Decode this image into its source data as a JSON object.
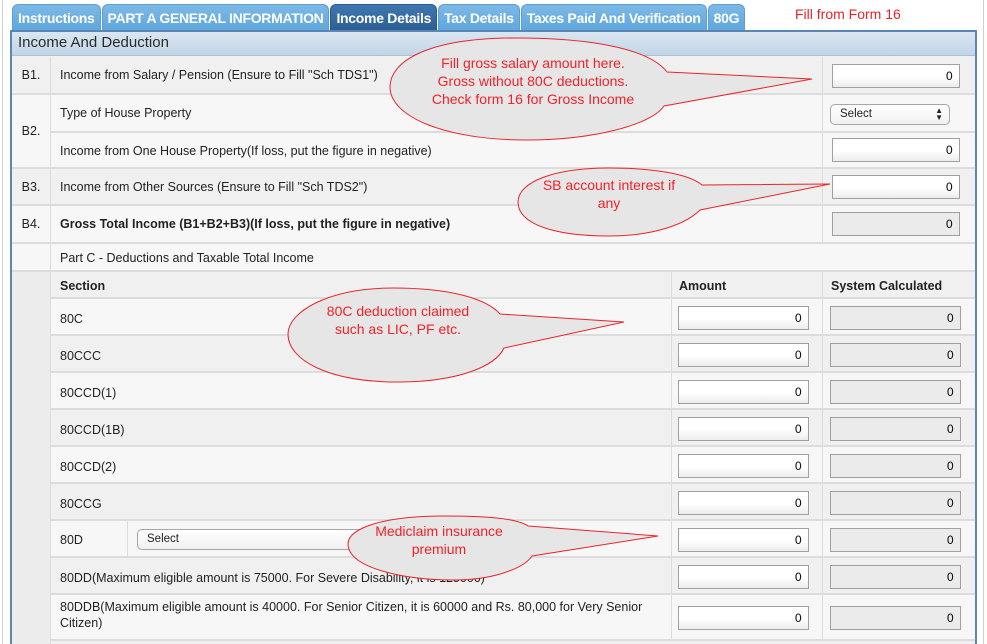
{
  "tabs": [
    {
      "label": "Instructions",
      "active": false
    },
    {
      "label": "PART A GENERAL INFORMATION",
      "active": false
    },
    {
      "label": "Income Details",
      "active": true
    },
    {
      "label": "Tax Details",
      "active": false
    },
    {
      "label": "Taxes Paid And Verification",
      "active": false
    },
    {
      "label": "80G",
      "active": false
    }
  ],
  "top_note": "Fill from Form 16",
  "panel": {
    "title": "Income And Deduction"
  },
  "income": {
    "b1": {
      "num": "B1.",
      "label": "Income from Salary / Pension (Ensure to Fill \"Sch TDS1\")",
      "value": "0"
    },
    "b2": {
      "num": "B2.",
      "type_label": "Type of House Property",
      "type_select": "Select",
      "label": "Income from One House Property(If loss, put the figure in negative)",
      "value": "0"
    },
    "b3": {
      "num": "B3.",
      "label": "Income from Other Sources (Ensure to Fill \"Sch TDS2\")",
      "value": "0"
    },
    "b4": {
      "num": "B4.",
      "label": "Gross Total Income (B1+B2+B3)(If loss, put the figure in negative)",
      "value": "0"
    }
  },
  "part_c": {
    "title": "Part C - Deductions and Taxable Total Income",
    "headers": {
      "section": "Section",
      "amount": "Amount",
      "system": "System Calculated"
    },
    "rows": [
      {
        "section": "80C",
        "amount": "0",
        "system": "0"
      },
      {
        "section": "80CCC",
        "amount": "0",
        "system": "0"
      },
      {
        "section": "80CCD(1)",
        "amount": "0",
        "system": "0"
      },
      {
        "section": "80CCD(1B)",
        "amount": "0",
        "system": "0"
      },
      {
        "section": "80CCD(2)",
        "amount": "0",
        "system": "0"
      },
      {
        "section": "80CCG",
        "amount": "0",
        "system": "0"
      },
      {
        "section": "80D",
        "select": "Select",
        "amount": "0",
        "system": "0"
      },
      {
        "section": "80DD(Maximum eligible amount is 75000. For Severe Disability, it is 125000)",
        "amount": "0",
        "system": "0"
      },
      {
        "section": "80DDB(Maximum eligible amount is 40000. For Senior Citizen, it is 60000 and Rs. 80,000 for Very Senior Citizen)",
        "amount": "0",
        "system": "0"
      }
    ]
  },
  "callouts": {
    "salary": "Fill gross salary amount here. Gross without 80C deductions. Check form 16 for Gross Income",
    "sb": "SB account interest if any",
    "c80": "80C deduction claimed such as LIC, PF etc.",
    "mediclaim": "Mediclaim insurance premium"
  },
  "colors": {
    "tab": "#6aaee0",
    "tab_active": "#33679e",
    "annotation": "#f0222a",
    "panel_border": "#5b86b8"
  }
}
